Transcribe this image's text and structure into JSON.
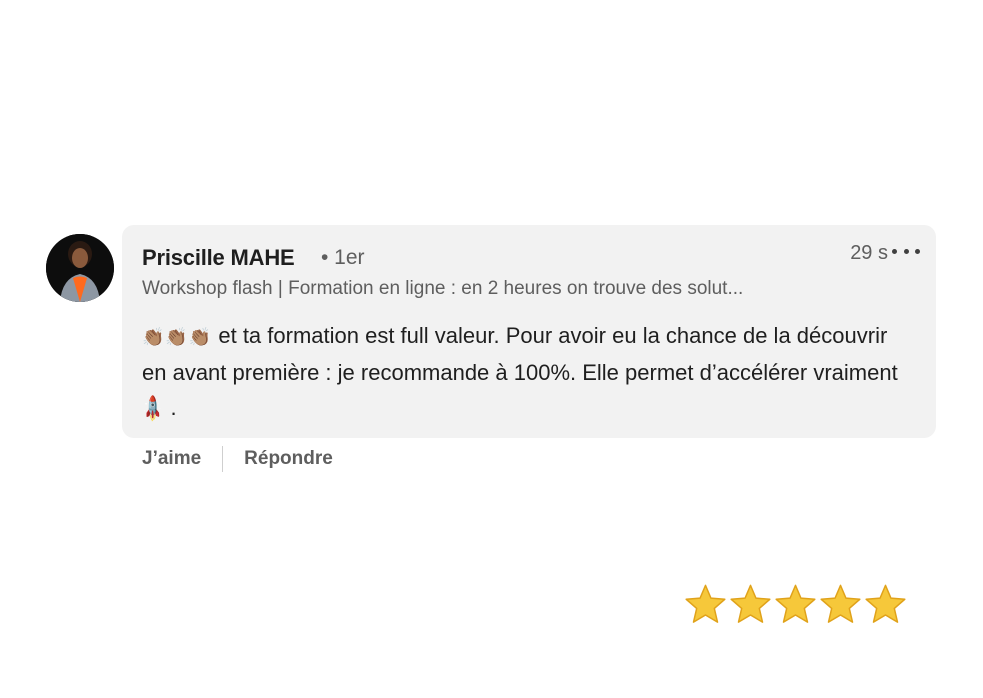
{
  "comment": {
    "author": "Priscille MAHE",
    "degree": "• 1er",
    "timestamp": "29 s",
    "headline": "Workshop flash | Formation en ligne : en 2 heures on trouve des solut...",
    "text_emoji_prefix": "👏🏽👏🏽👏🏽",
    "text_body": " et ta formation est full valeur. Pour avoir eu la chance de la découvrir en avant première : je recommande à 100%. Elle permet d’accélérer vraiment ",
    "text_emoji_suffix": "🚀",
    "text_end": " ."
  },
  "actions": {
    "like_label": "J’aime",
    "reply_label": "Répondre"
  },
  "rating": {
    "stars": 5,
    "max": 5,
    "star_color": "#f6c83a"
  },
  "icons": [
    "more-options-icon",
    "clap-icon",
    "rocket-icon",
    "star-icon"
  ],
  "colors": {
    "bubble_bg": "#f2f2f2",
    "text_primary": "#1f1f1f",
    "text_secondary": "#5e5e5e"
  }
}
